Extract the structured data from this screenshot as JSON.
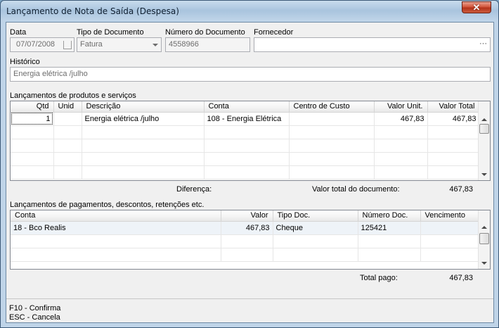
{
  "window": {
    "title": "Lançamento de Nota de Saída (Despesa)"
  },
  "header": {
    "data_label": "Data",
    "data_value": "07/07/2008",
    "tipo_label": "Tipo de Documento",
    "tipo_value": "Fatura",
    "numero_label": "Número do Documento",
    "numero_value": "4558966",
    "fornecedor_label": "Fornecedor",
    "fornecedor_value": "",
    "historico_label": "Histórico",
    "historico_value": "Energia elétrica /julho"
  },
  "products": {
    "section_label": "Lançamentos de produtos e serviços",
    "columns": [
      "Qtd",
      "Unid",
      "Descrição",
      "Conta",
      "Centro de Custo",
      "Valor Unit.",
      "Valor Total"
    ],
    "rows": [
      [
        "1",
        "",
        "Energia elétrica /julho",
        "108 - Energia Elétrica",
        "",
        "467,83",
        "467,83"
      ]
    ],
    "diferenca_label": "Diferença:",
    "diferenca_value": "",
    "total_doc_label": "Valor total do documento:",
    "total_doc_value": "467,83"
  },
  "payments": {
    "section_label": "Lançamentos de pagamentos, descontos, retenções etc.",
    "columns": [
      "Conta",
      "Valor",
      "Tipo Doc.",
      "Número Doc.",
      "Vencimento"
    ],
    "rows": [
      [
        "18 - Bco Realis",
        "467,83",
        "Cheque",
        "125421",
        ""
      ]
    ],
    "total_pago_label": "Total pago:",
    "total_pago_value": "467,83"
  },
  "footer": {
    "confirm": "F10 - Confirma",
    "cancel": "ESC - Cancela"
  },
  "icons": {
    "close": "close-icon",
    "calendar": "calendar-icon",
    "dropdown": "chevron-down-icon",
    "ellipsis": "ellipsis-icon",
    "ellipsis_glyph": "···"
  },
  "colors": {
    "title_bar": "#a9c4de",
    "close_button": "#c94a30",
    "client_bg": "#f0f0f0"
  }
}
